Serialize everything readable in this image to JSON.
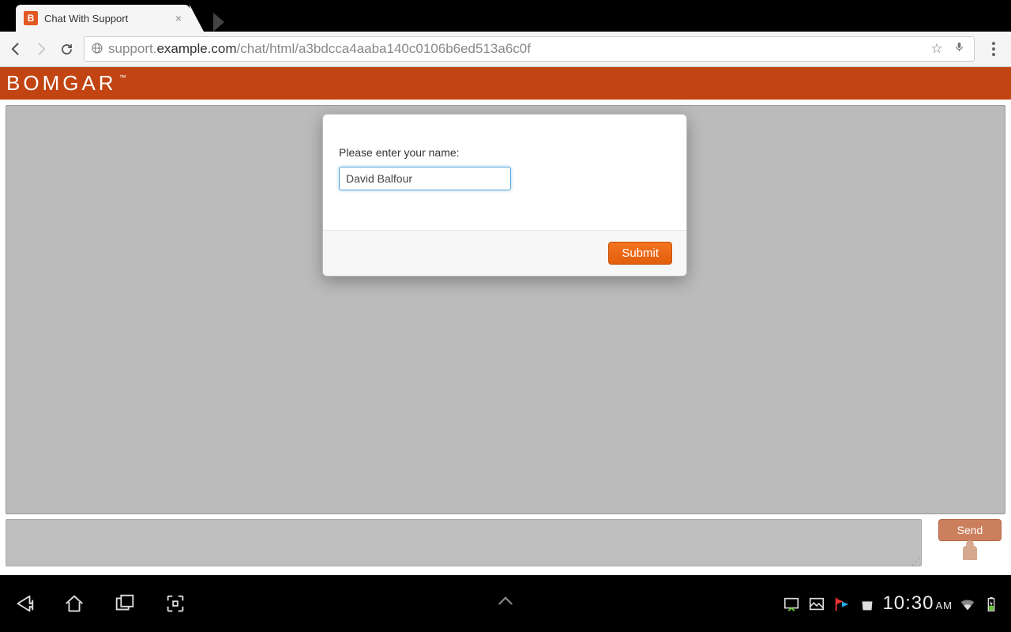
{
  "browser": {
    "tab_favicon_letter": "B",
    "tab_title": "Chat With Support",
    "url_prefix": "support.",
    "url_domain": "example.com",
    "url_path": "/chat/html/a3bdcca4aaba140c0106b6ed513a6c0f"
  },
  "brand": {
    "name": "BOMGAR",
    "tm": "™"
  },
  "modal": {
    "label": "Please enter your name:",
    "input_value": "David Balfour",
    "submit_label": "Submit"
  },
  "chat": {
    "send_label": "Send"
  },
  "android": {
    "clock_time": "10:30",
    "clock_ampm": "AM"
  }
}
